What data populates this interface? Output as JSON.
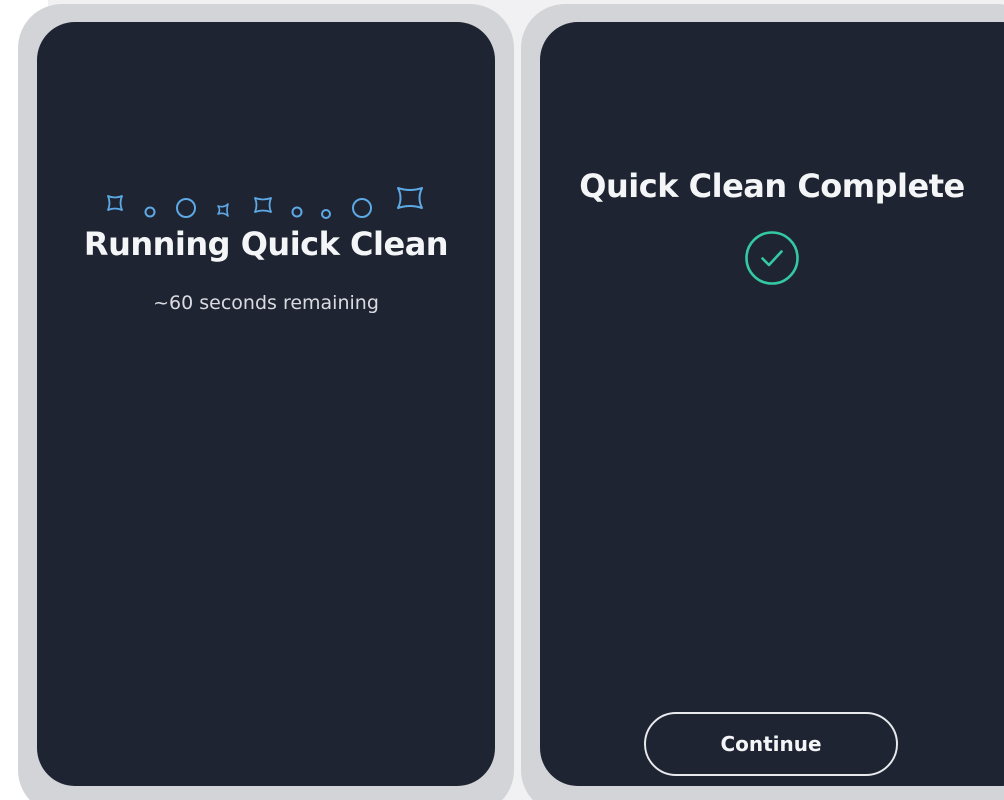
{
  "left_screen": {
    "title": "Running Quick Clean",
    "status": "~60 seconds remaining",
    "decoration_icon": "sparkles-icon"
  },
  "right_screen": {
    "title": "Quick Clean Complete",
    "status_icon": "check-circle-icon",
    "continue_label": "Continue"
  },
  "colors": {
    "screen_background": "#1f2432",
    "device_frame": "#d3d4d8",
    "sparkle_accent": "#5da9e6",
    "check_accent": "#35c9a3",
    "text": "#f4f5f7"
  }
}
